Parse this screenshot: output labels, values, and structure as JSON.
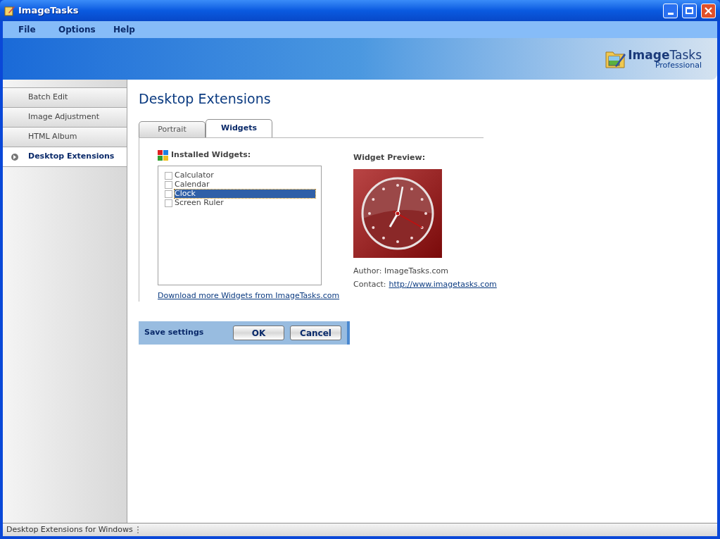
{
  "window": {
    "title": "ImageTasks"
  },
  "menu": [
    "File",
    "Options",
    "Help"
  ],
  "logo": {
    "name_bold": "Image",
    "name_rest": "Tasks",
    "edition": "Professional"
  },
  "sidebar": {
    "items": [
      {
        "label": "Batch Edit",
        "selected": false
      },
      {
        "label": "Image Adjustment",
        "selected": false
      },
      {
        "label": "HTML Album",
        "selected": false
      },
      {
        "label": "Desktop Extensions",
        "selected": true
      }
    ]
  },
  "page_title": "Desktop Extensions",
  "tabs": [
    {
      "label": "Portrait",
      "selected": false
    },
    {
      "label": "Widgets",
      "selected": true
    }
  ],
  "installed": {
    "heading": "Installed Widgets:",
    "items": [
      {
        "label": "Calculator",
        "checked": false,
        "selected": false
      },
      {
        "label": "Calendar",
        "checked": false,
        "selected": false
      },
      {
        "label": "Clock",
        "checked": false,
        "selected": true
      },
      {
        "label": "Screen Ruler",
        "checked": false,
        "selected": false
      }
    ],
    "link": "Download more Widgets from ImageTasks.com"
  },
  "preview": {
    "heading": "Widget Preview:",
    "author": "Author: ImageTasks.com",
    "contact_label": "Contact:",
    "contact_link": "http://www.imagetasks.com"
  },
  "save": {
    "label": "Save settings",
    "buttons": [
      "OK",
      "Cancel"
    ]
  },
  "status_bar": "Desktop Extensions for Windows"
}
